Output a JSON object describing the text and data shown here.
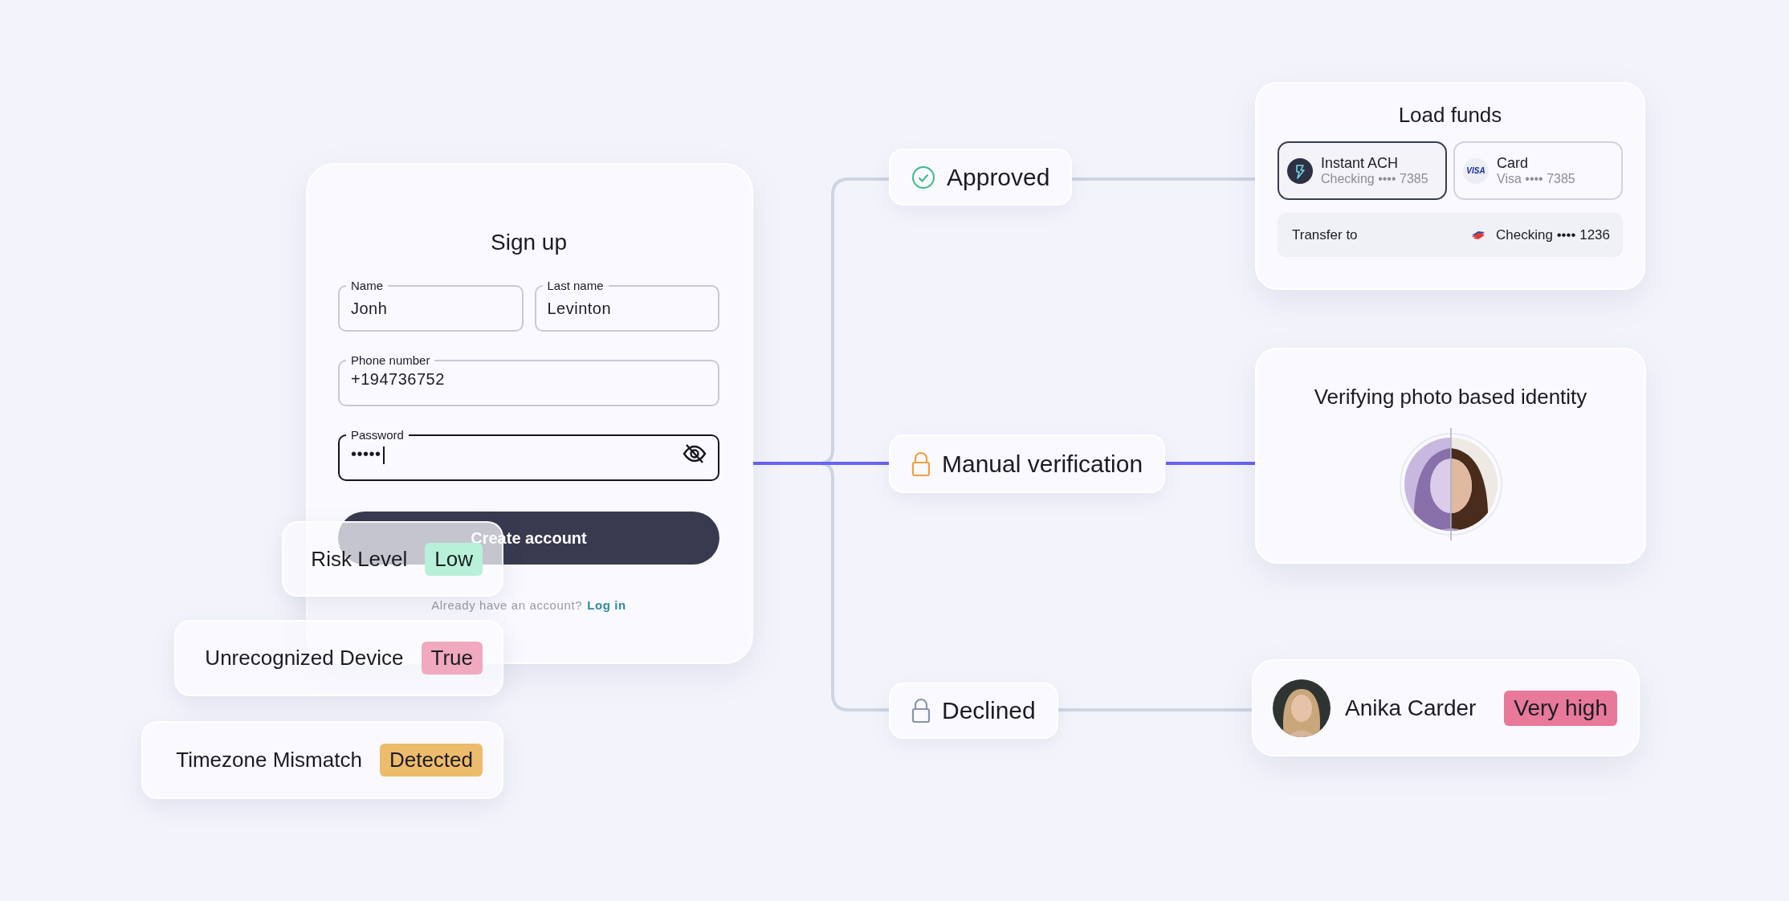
{
  "signup": {
    "title": "Sign up",
    "fields": [
      {
        "label": "Name",
        "value": "Jonh",
        "kind": "text",
        "focused": false
      },
      {
        "label": "Last name",
        "value": "Levinton",
        "kind": "text",
        "focused": false
      },
      {
        "label": "Phone number",
        "value": "+194736752",
        "kind": "text",
        "focused": false
      },
      {
        "label": "Password",
        "value": "•••••",
        "kind": "password",
        "focused": true
      }
    ],
    "button": "Create account",
    "footer": "Already have an account?",
    "link": "Log in"
  },
  "risk_signals": [
    {
      "label": "Risk Level",
      "value": "Low",
      "color": "#b9f0da"
    },
    {
      "label": "Unrecognized Device",
      "value": "True",
      "color": "#f0a9be"
    },
    {
      "label": "Timezone Mismatch",
      "value": "Detected",
      "color": "#edbb6c"
    }
  ],
  "outcomes": [
    {
      "label": "Approved",
      "kind": "approved",
      "selected": false
    },
    {
      "label": "Manual verification",
      "kind": "manual",
      "selected": true
    },
    {
      "label": "Declined",
      "kind": "declined",
      "selected": false
    }
  ],
  "load_funds": {
    "title": "Load funds",
    "options": [
      {
        "kind": "ach",
        "title": "Instant ACH",
        "subtitle": "Checking •••• 7385",
        "selected": true
      },
      {
        "kind": "card",
        "title": "Card",
        "subtitle": "Visa •••• 7385",
        "logo": "VISA",
        "selected": false
      }
    ],
    "transfer": {
      "label": "Transfer to",
      "value": "Checking •••• 1236"
    }
  },
  "identity_check": {
    "title": "Verifying photo based identity"
  },
  "applicant": {
    "name": "Anika Carder",
    "risk": "Very high",
    "color": "#e8799a"
  }
}
